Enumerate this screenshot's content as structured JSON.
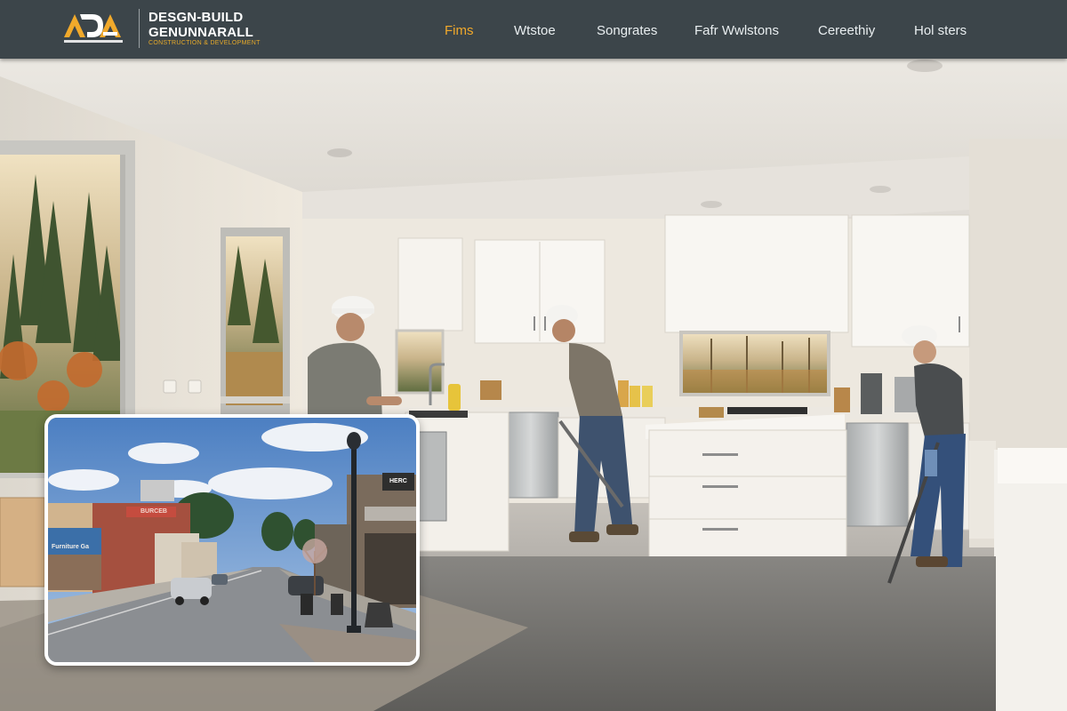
{
  "header": {
    "logo": {
      "mark": "DA",
      "line1": "DESGN-BUILD",
      "line2": "GENUNNARALL",
      "tagline": "CONSTRUCTION & DEVELOPMENT"
    },
    "nav": [
      {
        "label": "Fims",
        "active": true
      },
      {
        "label": "Wtstoe",
        "active": false
      },
      {
        "label": "Songrates",
        "active": false
      },
      {
        "label": "Fafr Wwlstons",
        "active": false
      },
      {
        "label": "Cereethiy",
        "active": false
      },
      {
        "label": "Hol sters",
        "active": false
      }
    ],
    "colors": {
      "bar": "#3c454a",
      "accent": "#f1a92b"
    }
  },
  "hero": {
    "scene": "kitchen-renovation-with-three-workers-in-hard-hats"
  },
  "inset": {
    "scene": "small-town-main-street",
    "signs": {
      "store_left": "Furniture Ga",
      "store_red": "BURCEB",
      "store_right": "HERC"
    }
  }
}
